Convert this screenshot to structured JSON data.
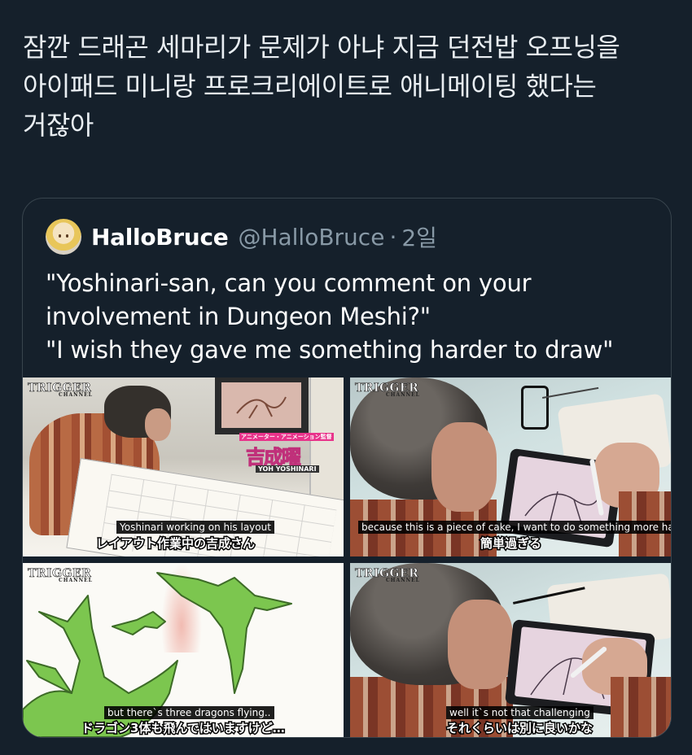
{
  "tweet": {
    "lines": [
      "잠깐 드래곤 세마리가 문제가 아냐 지금 던전밥 오프닝을",
      "아이패드 미니랑 프로크리에이트로 애니메이팅 했다는",
      "거잖아"
    ]
  },
  "quoted_tweet": {
    "display_name": "HalloBruce",
    "handle": "@HalloBruce",
    "separator": "·",
    "time": "2일",
    "text_lines": [
      "\"Yoshinari-san, can you comment on your",
      "involvement in Dungeon Meshi?\"",
      "\"I wish they gave me something harder to draw\""
    ],
    "media": {
      "logo": "TRIGGER",
      "logo_sub": "CHANNEL",
      "panels": [
        {
          "caption_en": "Yoshinari working on his layout",
          "caption_jp": "レイアウト作業中の吉成さん",
          "nametag_role": "アニメーター・アニメーション監督",
          "nametag_kanji": "吉成曜",
          "nametag_romaji": "YOH YOSHINARI"
        },
        {
          "caption_en": "because this is a piece of cake, I want to do something more har",
          "caption_jp": "簡単過ぎる"
        },
        {
          "caption_en": "but there`s three dragons flying..",
          "caption_jp": "ドラゴン3体も飛んではいますけど…"
        },
        {
          "caption_en": "well it`s not that challenging",
          "caption_jp": "それくらいは別に良いかな"
        }
      ]
    }
  },
  "colors": {
    "background": "#15202b",
    "border": "#38444d",
    "secondary_text": "#8899a6",
    "dragon_green": "#7cc64f"
  }
}
